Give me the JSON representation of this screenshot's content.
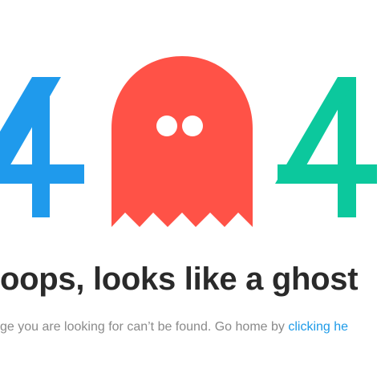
{
  "error": {
    "code_left": "4",
    "code_right": "4",
    "headline": "oops, looks like a ghost",
    "message_prefix": "ge you are looking for can’t be found. Go home by ",
    "message_link": "clicking he"
  },
  "colors": {
    "left_digit": "#1f9aec",
    "right_digit": "#0cc89d",
    "ghost": "#ff5247",
    "ghost_eyes": "#ffffff",
    "headline": "#2a2a2a",
    "message": "#8a8a8a",
    "link": "#1e9be8"
  },
  "icons": {
    "ghost": "ghost-icon"
  }
}
